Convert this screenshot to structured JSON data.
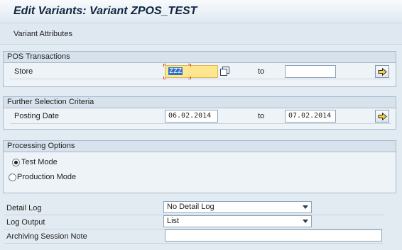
{
  "window": {
    "title": "Edit Variants: Variant ZPOS_TEST"
  },
  "toolbar": {
    "variant_attributes_label": "Variant Attributes"
  },
  "pos_transactions": {
    "header": "POS Transactions",
    "store_label": "Store",
    "store_from": "ZZZ",
    "to_label": "to",
    "store_to": ""
  },
  "further_selection": {
    "header": "Further Selection Criteria",
    "posting_date_label": "Posting Date",
    "posting_date_from": "06.02.2014",
    "to_label": "to",
    "posting_date_to": "07.02.2014"
  },
  "processing_options": {
    "header": "Processing Options",
    "test_mode_label": "Test Mode",
    "production_mode_label": "Production Mode",
    "selected": "test_mode"
  },
  "detail_log": {
    "label": "Detail Log",
    "value": "No Detail Log"
  },
  "log_output": {
    "label": "Log Output",
    "value": "List"
  },
  "archiving_note": {
    "label": "Archiving Session Note",
    "value": ""
  },
  "icons": {
    "multiple_selection": "multiple-selection-arrow-icon",
    "copy": "copy-values-icon",
    "dropdown": "chevron-down-icon"
  },
  "colors": {
    "background": "#e3ebf2",
    "required_field": "#fde68f",
    "selection_highlight": "#2f70c9"
  }
}
